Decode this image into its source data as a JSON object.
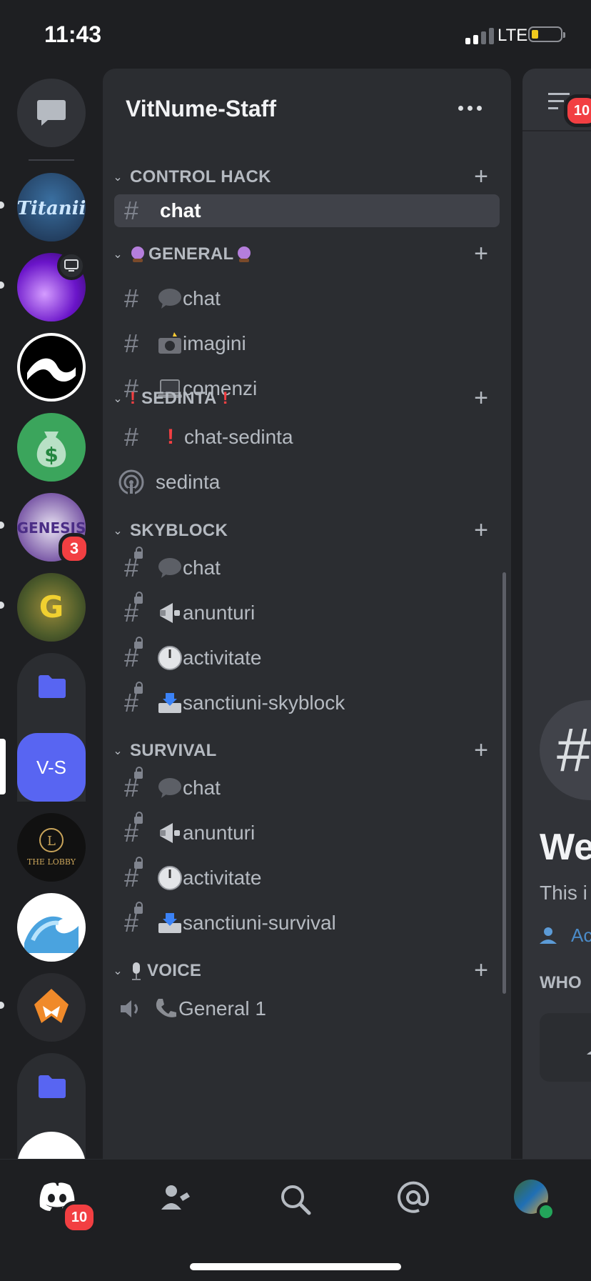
{
  "status": {
    "time": "11:43",
    "network": "LTE"
  },
  "server": {
    "name": "VitNume-Staff"
  },
  "rail": {
    "badges": {
      "genesis": "3",
      "bottom": "10"
    },
    "vs_label": "V-S",
    "lobby_label": "THE LOBBY"
  },
  "channels": {
    "control_hack": {
      "label": "CONTROL HACK",
      "selected": "chat"
    },
    "general": {
      "label": "GENERAL",
      "items": [
        "chat",
        "imagini",
        "comenzi"
      ]
    },
    "sedinta": {
      "label": "SEDINTA",
      "items": [
        "chat-sedinta",
        "sedinta"
      ]
    },
    "skyblock": {
      "label": "SKYBLOCK",
      "items": [
        "chat",
        "anunturi",
        "activitate",
        "sanctiuni-skyblock"
      ]
    },
    "survival": {
      "label": "SURVIVAL",
      "items": [
        "chat",
        "anunturi",
        "activitate",
        "sanctiuni-survival"
      ]
    },
    "voice": {
      "label": "VOICE",
      "items": [
        "General 1"
      ]
    }
  },
  "right": {
    "title_partial": "We",
    "desc_partial": "This i",
    "add_partial": "Ac",
    "who_partial": "WHO",
    "badge": "10"
  },
  "colors": {
    "accent": "#5865f2",
    "danger": "#f23f42",
    "bg": "#1e1f22",
    "panel": "#2b2d31"
  }
}
